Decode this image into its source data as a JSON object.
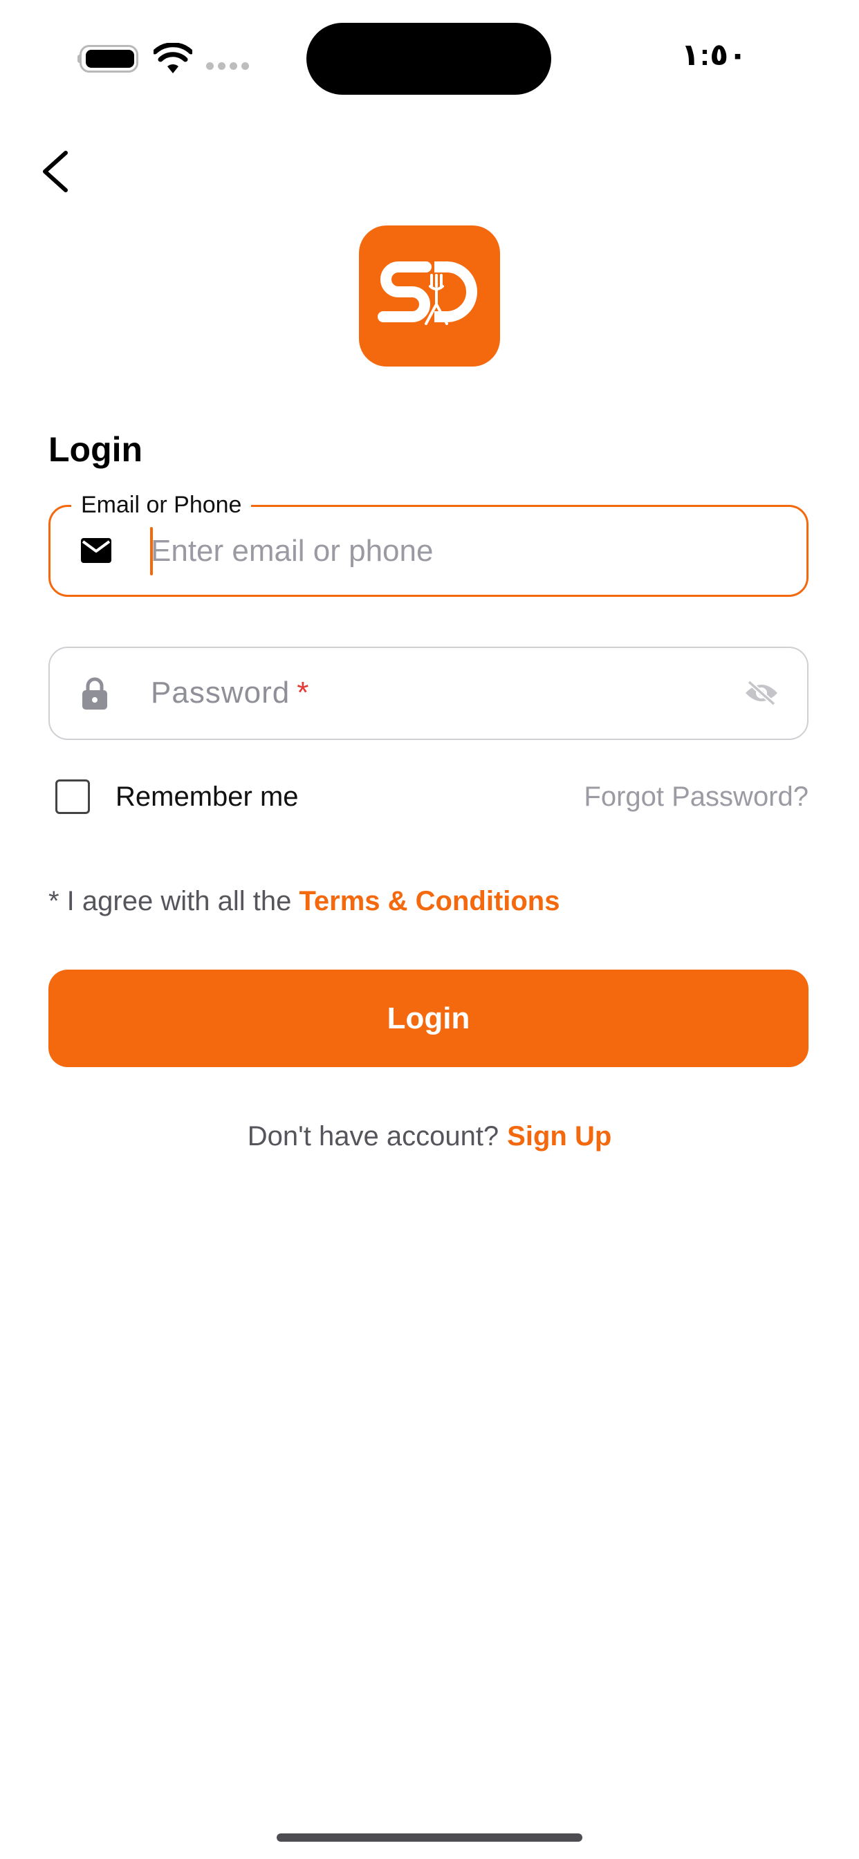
{
  "status_bar": {
    "time": "١:٥٠",
    "icons": [
      "battery-icon",
      "wifi-icon",
      "signal-icon"
    ]
  },
  "nav": {
    "back_icon": "chevron-left-icon"
  },
  "logo": {
    "icon": "app-logo-icon",
    "color": "#f5690e"
  },
  "login_form": {
    "title": "Login",
    "email": {
      "label": "Email or Phone",
      "placeholder": "Enter email or phone",
      "value": "",
      "icon": "mail-icon"
    },
    "password": {
      "placeholder": "Password",
      "required_mark": "*",
      "value": "",
      "icon": "lock-icon",
      "toggle_icon": "eye-off-icon"
    },
    "remember_me": {
      "label": "Remember me",
      "checked": false
    },
    "forgot_password": "Forgot Password?",
    "terms": {
      "prefix": "* I agree with all the",
      "link": "Terms & Conditions"
    },
    "submit_label": "Login",
    "signup": {
      "prompt": "Don't have account?",
      "link": "Sign Up"
    }
  },
  "colors": {
    "accent": "#f5690e",
    "required": "#e53935",
    "muted_text": "#9b9ba3"
  }
}
